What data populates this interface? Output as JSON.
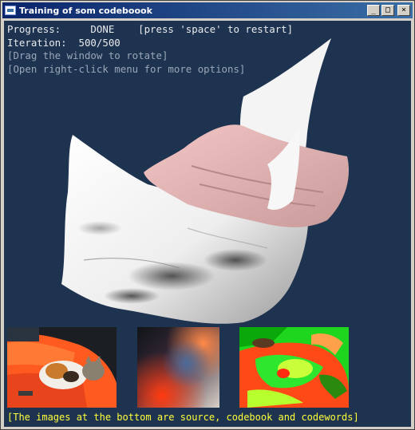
{
  "window": {
    "title": "Training of som codeboook",
    "buttons": {
      "minimize": "_",
      "maximize": "□",
      "close": "×"
    }
  },
  "hud": {
    "progress_line": "Progress:     DONE    [press 'space' to restart]",
    "iteration_line": "Iteration:  500/500",
    "hint_rotate": "[Drag the window to rotate]",
    "hint_menu": "[Open right-click menu for more options]"
  },
  "thumbnails": [
    {
      "label": "source"
    },
    {
      "label": "codebook"
    },
    {
      "label": "codewords"
    }
  ],
  "footer": "[The images at the bottom are source, codebook and codewords]",
  "colors": {
    "viewport_bg": "#1e3350",
    "hud_text": "#e8eaed",
    "hint_text": "#9aa7b8",
    "footer_text": "#ffff3a",
    "title_bar": "#0a246a"
  }
}
